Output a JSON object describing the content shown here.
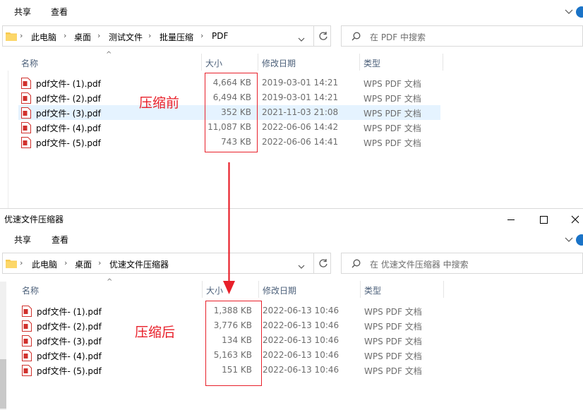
{
  "window_before": {
    "ribbon": {
      "share": "共享",
      "view": "查看"
    },
    "address": {
      "crumbs": [
        "此电脑",
        "桌面",
        "测试文件",
        "批量压缩",
        "PDF"
      ]
    },
    "search": {
      "placeholder": "在 PDF 中搜索"
    },
    "columns": {
      "name": "名称",
      "size": "大小",
      "modified": "修改日期",
      "type": "类型"
    },
    "files": [
      {
        "name": "pdf文件- (1).pdf",
        "size": "4,664 KB",
        "modified": "2019-03-01 14:21",
        "type": "WPS PDF 文档",
        "selected": false
      },
      {
        "name": "pdf文件- (2).pdf",
        "size": "6,494 KB",
        "modified": "2019-03-01 14:21",
        "type": "WPS PDF 文档",
        "selected": false
      },
      {
        "name": "pdf文件- (3).pdf",
        "size": "352 KB",
        "modified": "2021-11-03 21:08",
        "type": "WPS PDF 文档",
        "selected": true
      },
      {
        "name": "pdf文件- (4).pdf",
        "size": "11,087 KB",
        "modified": "2022-06-06 14:42",
        "type": "WPS PDF 文档",
        "selected": false
      },
      {
        "name": "pdf文件- (5).pdf",
        "size": "743 KB",
        "modified": "2022-06-06 14:41",
        "type": "WPS PDF 文档",
        "selected": false
      }
    ],
    "annotation": "压缩前"
  },
  "window_after": {
    "title": "优速文件压缩器",
    "ribbon": {
      "share": "共享",
      "view": "查看"
    },
    "address": {
      "crumbs": [
        "此电脑",
        "桌面",
        "优速文件压缩器"
      ]
    },
    "search": {
      "placeholder": "在 优速文件压缩器 中搜索"
    },
    "columns": {
      "name": "名称",
      "size": "大小",
      "modified": "修改日期",
      "type": "类型"
    },
    "files": [
      {
        "name": "pdf文件- (1).pdf",
        "size": "1,388 KB",
        "modified": "2022-06-13 10:46",
        "type": "WPS PDF 文档"
      },
      {
        "name": "pdf文件- (2).pdf",
        "size": "3,776 KB",
        "modified": "2022-06-13 10:46",
        "type": "WPS PDF 文档"
      },
      {
        "name": "pdf文件- (3).pdf",
        "size": "134 KB",
        "modified": "2022-06-13 10:46",
        "type": "WPS PDF 文档"
      },
      {
        "name": "pdf文件- (4).pdf",
        "size": "5,163 KB",
        "modified": "2022-06-13 10:46",
        "type": "WPS PDF 文档"
      },
      {
        "name": "pdf文件- (5).pdf",
        "size": "151 KB",
        "modified": "2022-06-13 10:46",
        "type": "WPS PDF 文档"
      }
    ],
    "annotation": "压缩后"
  },
  "icons": {
    "folder": "folder-icon",
    "chevron": "chevron-right-icon",
    "refresh": "refresh-icon",
    "search": "search-icon",
    "pdf": "pdf-file-icon",
    "minimize": "minimize-icon",
    "maximize": "maximize-icon",
    "close": "close-icon",
    "help": "help-icon"
  },
  "colors": {
    "annotation_red": "#e8202a",
    "selection": "#e5f3ff",
    "header_text": "#4c607a",
    "pdf_red": "#d0312d"
  }
}
